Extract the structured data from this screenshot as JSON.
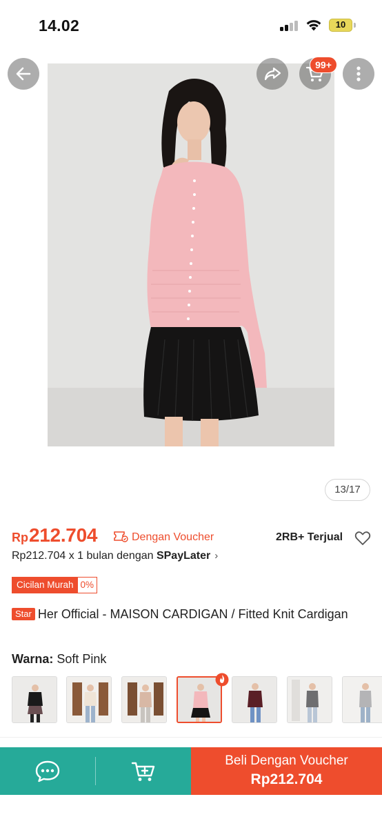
{
  "status_bar": {
    "time": "14.02",
    "battery": "10"
  },
  "header": {
    "cart_badge": "99+"
  },
  "gallery": {
    "counter": "13/17"
  },
  "price": {
    "currency": "Rp",
    "amount": "212.704",
    "voucher_label": "Dengan Voucher",
    "sold": "2RB+ Terjual"
  },
  "spaylater": {
    "text": "Rp212.704 x 1 bulan dengan ",
    "brand": "SPayLater",
    "chevron": "›"
  },
  "installment": {
    "label": "Cicilan Murah",
    "rate": "0%"
  },
  "product": {
    "badge": "Star",
    "title": "Her Official - MAISON CARDIGAN / Fitted Knit Cardigan"
  },
  "variant": {
    "label": "Warna:",
    "value": "Soft Pink",
    "thumbnails": [
      {
        "name": "thumb-black-top"
      },
      {
        "name": "thumb-cream-knit"
      },
      {
        "name": "thumb-beige-knit"
      },
      {
        "name": "thumb-soft-pink",
        "selected": true
      },
      {
        "name": "thumb-maroon"
      },
      {
        "name": "thumb-grey"
      },
      {
        "name": "thumb-light-grey"
      }
    ]
  },
  "bottom_bar": {
    "buy_label": "Beli Dengan Voucher",
    "buy_price": "Rp212.704"
  },
  "colors": {
    "accent": "#ee4d2d",
    "teal": "#26aa99"
  }
}
